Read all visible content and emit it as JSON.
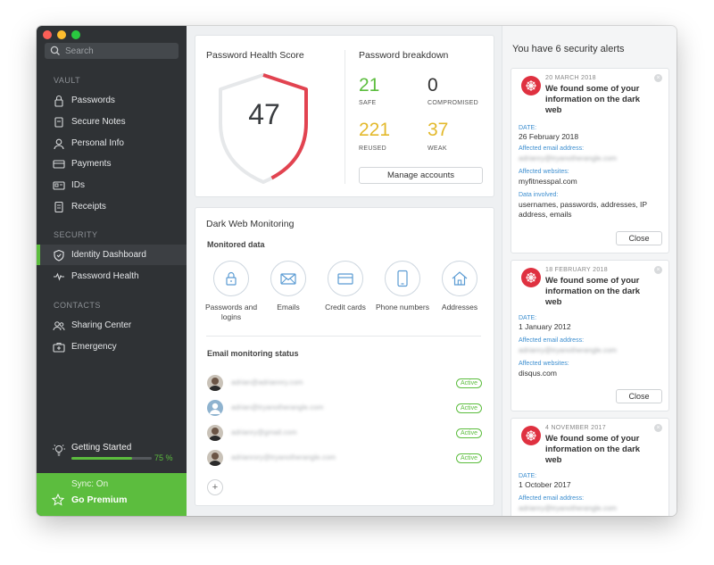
{
  "search": {
    "placeholder": "Search"
  },
  "sidebar": {
    "vault_header": "VAULT",
    "vault_items": [
      {
        "label": "Passwords",
        "icon": "lock-icon"
      },
      {
        "label": "Secure Notes",
        "icon": "note-icon"
      },
      {
        "label": "Personal Info",
        "icon": "person-icon"
      },
      {
        "label": "Payments",
        "icon": "credit-card-icon"
      },
      {
        "label": "IDs",
        "icon": "id-card-icon"
      },
      {
        "label": "Receipts",
        "icon": "receipt-icon"
      }
    ],
    "security_header": "SECURITY",
    "security_items": [
      {
        "label": "Identity Dashboard",
        "icon": "shield-icon",
        "active": true
      },
      {
        "label": "Password Health",
        "icon": "pulse-icon"
      }
    ],
    "contacts_header": "CONTACTS",
    "contacts_items": [
      {
        "label": "Sharing Center",
        "icon": "people-icon"
      },
      {
        "label": "Emergency",
        "icon": "first-aid-icon"
      }
    ],
    "getting_started": {
      "label": "Getting Started",
      "progress_percent": 75,
      "progress_text": "75 %"
    },
    "sync": "Sync: On",
    "premium": "Go Premium",
    "accent": "#5cbd3e"
  },
  "health": {
    "title": "Password Health Score",
    "score": "47",
    "score_fraction": 0.47,
    "breakdown_title": "Password breakdown",
    "safe": {
      "value": "21",
      "label": "SAFE",
      "color": "#5cbd3e"
    },
    "compromised": {
      "value": "0",
      "label": "COMPROMISED",
      "color": "#333333"
    },
    "reused": {
      "value": "221",
      "label": "REUSED",
      "color": "#e3b92c"
    },
    "weak": {
      "value": "37",
      "label": "WEAK",
      "color": "#e3b92c"
    },
    "manage_label": "Manage accounts"
  },
  "dark_web": {
    "title": "Dark Web Monitoring",
    "monitored_title": "Monitored data",
    "categories": [
      {
        "label": "Passwords and logins",
        "icon": "lock-icon"
      },
      {
        "label": "Emails",
        "icon": "envelope-icon"
      },
      {
        "label": "Credit cards",
        "icon": "credit-card-icon"
      },
      {
        "label": "Phone numbers",
        "icon": "phone-icon"
      },
      {
        "label": "Addresses",
        "icon": "house-icon"
      }
    ],
    "status_title": "Email monitoring status",
    "emails": [
      {
        "email": "adrian@adriannry.com",
        "status": "Active"
      },
      {
        "email": "adrian@tryanotherangle.com",
        "status": "Active"
      },
      {
        "email": "adrianry@gmail.com",
        "status": "Active"
      },
      {
        "email": "adrianrory@tryanotherangle.com",
        "status": "Active"
      }
    ],
    "add_label": "+"
  },
  "alerts": {
    "title": "You have 6 security alerts",
    "items": [
      {
        "date": "20 MARCH 2018",
        "heading": "We found some of your information on the dark web",
        "date_label": "DATE:",
        "date_value": "26 February 2018",
        "email_label": "Affected email address:",
        "email_value": "adrianry@tryanotherangle.com",
        "sites_label": "Affected websites:",
        "sites_value": "myfitnesspal.com",
        "data_label": "Data involved:",
        "data_value": "usernames, passwords, addresses, IP address, emails",
        "close_label": "Close"
      },
      {
        "date": "18 FEBRUARY 2018",
        "heading": "We found some of your information on the dark web",
        "date_label": "DATE:",
        "date_value": "1 January 2012",
        "email_label": "Affected email address:",
        "email_value": "adrianry@tryanotherangle.com",
        "sites_label": "Affected websites:",
        "sites_value": "disqus.com",
        "close_label": "Close"
      },
      {
        "date": "4 NOVEMBER 2017",
        "heading": "We found some of your information on the dark web",
        "date_label": "DATE:",
        "date_value": "1 October 2017",
        "email_label": "Affected email address:",
        "email_value": "adrianry@tryanotherangle.com"
      }
    ],
    "accent": "#df3140"
  }
}
